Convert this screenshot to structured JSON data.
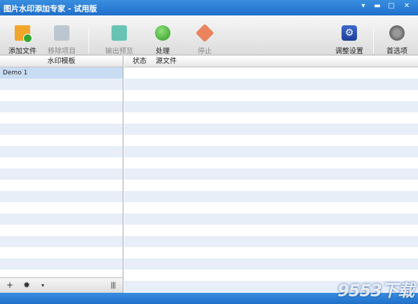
{
  "window": {
    "title": "图片水印添加专家 - 试用版",
    "menu_glyph": "▾",
    "min_glyph": "▬",
    "max_glyph": "□",
    "close_glyph": "✕"
  },
  "toolbar": {
    "add_files": "添加文件",
    "remove_item": "移除项目",
    "output_preview": "输出预览",
    "process": "处理",
    "stop": "停止",
    "adjust_settings": "调整设置",
    "preferences": "首选项"
  },
  "left_panel": {
    "header": "水印模板",
    "items": [
      "Demo 1"
    ],
    "footer": {
      "add": "+",
      "gear": "✹",
      "dropdown": "▾",
      "columns": "|||"
    }
  },
  "right_panel": {
    "columns": [
      "状态",
      "源文件"
    ]
  },
  "watermark": {
    "text": "9553下载"
  },
  "colors": {
    "title_bar": "#1f6fc9",
    "selection": "#c8dcf4",
    "row_alt": "#e8eef8"
  }
}
